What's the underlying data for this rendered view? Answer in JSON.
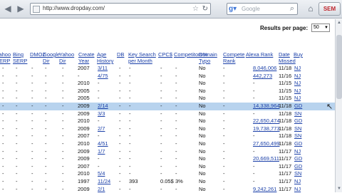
{
  "browser": {
    "back_icon": "back-arrow-icon",
    "forward_icon": "forward-arrow-icon",
    "url": "http://www.dropday.com/",
    "search_placeholder": "Google",
    "extension_label": "SEM"
  },
  "page": {
    "results_per_page_label": "Results per page:",
    "results_per_page_value": "50"
  },
  "table": {
    "headers": [
      "Yahoo SERP",
      "Bing SERP",
      "DMOZ",
      "Google Dir",
      "Yahoo Dir",
      "Create Year",
      "Age History",
      "DB",
      "Key Search per Month",
      "CPC$",
      "Competitors%",
      "Domain Typo",
      "Compete Rank",
      "Alexa Rank",
      "Date Missed",
      "Buy"
    ],
    "rows": [
      {
        "create": "2007",
        "age": "3/11",
        "db": "-",
        "ks": "-",
        "cpc": "-",
        "comp": "-",
        "typo": "No",
        "crank": "-",
        "alexa": "8,046,006",
        "date": "11/18",
        "buy": "NJ"
      },
      {
        "create": "-",
        "age": "4/75",
        "db": "-",
        "ks": "-",
        "cpc": "-",
        "comp": "-",
        "typo": "No",
        "crank": "-",
        "alexa": "442,273",
        "date": "11/16",
        "buy": "NJ"
      },
      {
        "create": "2010",
        "age": "-",
        "db": "-",
        "ks": "-",
        "cpc": "-",
        "comp": "-",
        "typo": "No",
        "crank": "-",
        "alexa": "-",
        "date": "11/15",
        "buy": "NJ"
      },
      {
        "create": "2005",
        "age": "-",
        "db": "-",
        "ks": "-",
        "cpc": "-",
        "comp": "-",
        "typo": "No",
        "crank": "-",
        "alexa": "-",
        "date": "11/15",
        "buy": "NJ"
      },
      {
        "create": "2005",
        "age": "-",
        "db": "-",
        "ks": "-",
        "cpc": "-",
        "comp": "-",
        "typo": "No",
        "crank": "-",
        "alexa": "-",
        "date": "11/15",
        "buy": "NJ"
      },
      {
        "create": "2009",
        "age": "2/14",
        "db": "-",
        "ks": "-",
        "cpc": "-",
        "comp": "-",
        "typo": "No",
        "crank": "-",
        "alexa": "14,338,964",
        "date": "11/18",
        "buy": "GD"
      },
      {
        "create": "2009",
        "age": "3/3",
        "db": "-",
        "ks": "-",
        "cpc": "-",
        "comp": "-",
        "typo": "No",
        "crank": "-",
        "alexa": "-",
        "date": "11/18",
        "buy": "SN"
      },
      {
        "create": "2010",
        "age": "-",
        "db": "-",
        "ks": "-",
        "cpc": "-",
        "comp": "-",
        "typo": "No",
        "crank": "-",
        "alexa": "22,650,474",
        "date": "11/18",
        "buy": "GD"
      },
      {
        "create": "2009",
        "age": "2/7",
        "db": "-",
        "ks": "-",
        "cpc": "-",
        "comp": "-",
        "typo": "No",
        "crank": "-",
        "alexa": "19,738,773",
        "date": "11/18",
        "buy": "SN"
      },
      {
        "create": "2007",
        "age": "-",
        "db": "-",
        "ks": "-",
        "cpc": "-",
        "comp": "-",
        "typo": "No",
        "crank": "-",
        "alexa": "-",
        "date": "11/18",
        "buy": "SN"
      },
      {
        "create": "2010",
        "age": "4/51",
        "db": "-",
        "ks": "-",
        "cpc": "-",
        "comp": "-",
        "typo": "No",
        "crank": "-",
        "alexa": "27,650,499",
        "date": "11/18",
        "buy": "GD"
      },
      {
        "create": "2009",
        "age": "1/7",
        "db": "-",
        "ks": "-",
        "cpc": "-",
        "comp": "-",
        "typo": "No",
        "crank": "-",
        "alexa": "-",
        "date": "11/17",
        "buy": "NJ"
      },
      {
        "create": "2009",
        "age": "-",
        "db": "-",
        "ks": "-",
        "cpc": "-",
        "comp": "-",
        "typo": "No",
        "crank": "-",
        "alexa": "20,669,511",
        "date": "11/17",
        "buy": "GD"
      },
      {
        "create": "2007",
        "age": "-",
        "db": "-",
        "ks": "-",
        "cpc": "-",
        "comp": "-",
        "typo": "No",
        "crank": "-",
        "alexa": "-",
        "date": "11/17",
        "buy": "GD"
      },
      {
        "create": "2010",
        "age": "5/4",
        "db": "-",
        "ks": "-",
        "cpc": "-",
        "comp": "-",
        "typo": "No",
        "crank": "-",
        "alexa": "-",
        "date": "11/17",
        "buy": "SN"
      },
      {
        "create": "1997",
        "age": "11/24",
        "db": "-",
        "ks": "393",
        "cpc": "0.05$",
        "comp": "3%",
        "typo": "No",
        "crank": "-",
        "alexa": "-",
        "date": "11/17",
        "buy": "NJ"
      },
      {
        "create": "2009",
        "age": "2/1",
        "db": "-",
        "ks": "-",
        "cpc": "-",
        "comp": "-",
        "typo": "No",
        "crank": "-",
        "alexa": "9,242,261",
        "date": "11/17",
        "buy": "NJ"
      }
    ]
  }
}
